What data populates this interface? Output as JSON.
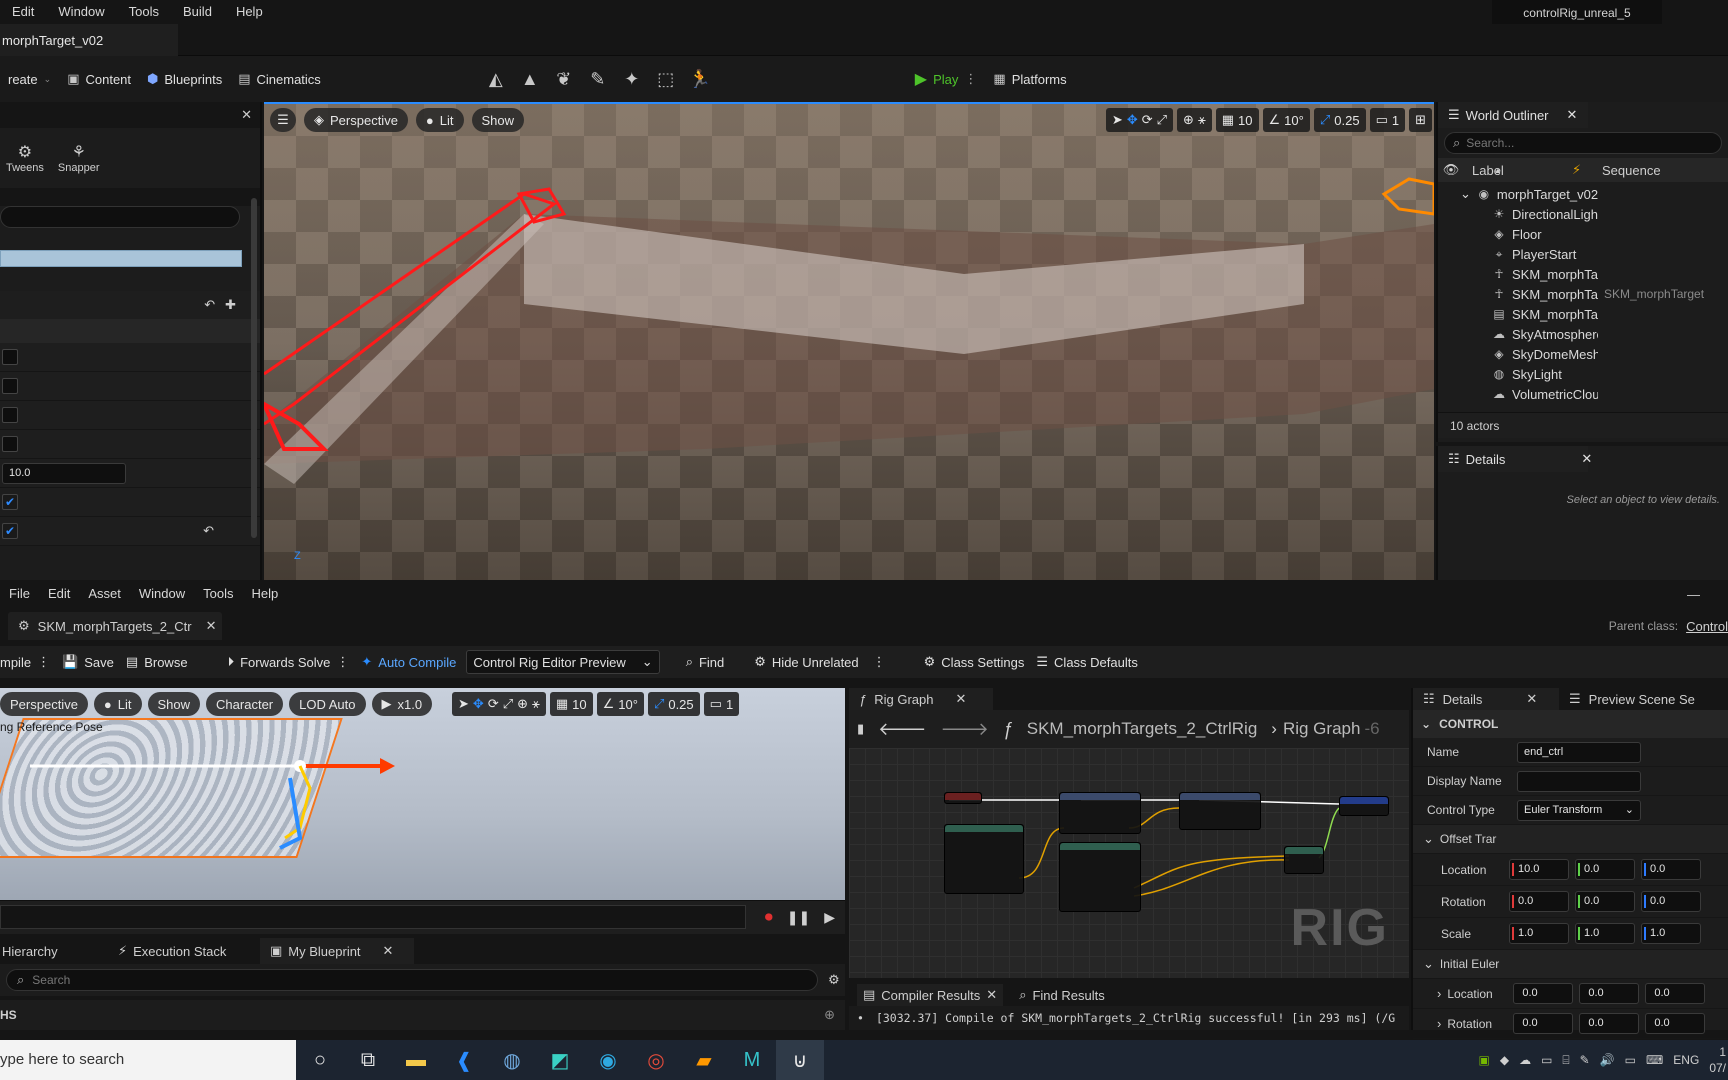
{
  "top_menu": [
    "Edit",
    "Window",
    "Tools",
    "Build",
    "Help"
  ],
  "project_name": "controlRig_unreal_5",
  "level_tab": "morphTarget_v02",
  "main_toolbar": {
    "create": "reate",
    "content": "Content",
    "blueprints": "Blueprints",
    "cinematics": "Cinematics",
    "play": "Play",
    "platforms": "Platforms"
  },
  "left_panel": {
    "tool_tweens": "Tweens",
    "tool_snapper": "Snapper",
    "value_field": "10.0"
  },
  "main_viewport": {
    "perspective": "Perspective",
    "lit": "Lit",
    "show": "Show",
    "grid_snap": "10",
    "rot_snap": "10°",
    "scale_snap": "0.25",
    "camera_speed": "1",
    "axis_z": "Z"
  },
  "world_outliner": {
    "title": "World Outliner",
    "search_placeholder": "Search...",
    "col_label": "Label",
    "col_sequence": "Sequence",
    "items": [
      {
        "label": "morphTarget_v02",
        "icon": "world-icon",
        "sequence": ""
      },
      {
        "label": "DirectionalLight",
        "icon": "sun-icon",
        "sequence": ""
      },
      {
        "label": "Floor",
        "icon": "cube-icon",
        "sequence": ""
      },
      {
        "label": "PlayerStart",
        "icon": "gamepad-icon",
        "sequence": ""
      },
      {
        "label": "SKM_morphTar",
        "icon": "skeleton-icon",
        "sequence": ""
      },
      {
        "label": "SKM_morphTar",
        "icon": "skeleton-icon",
        "sequence": "SKM_morphTarget"
      },
      {
        "label": "SKM_morphTar",
        "icon": "sequence-icon",
        "sequence": ""
      },
      {
        "label": "SkyAtmosphere",
        "icon": "atmosphere-icon",
        "sequence": ""
      },
      {
        "label": "SkyDomeMesh",
        "icon": "cube-icon",
        "sequence": ""
      },
      {
        "label": "SkyLight",
        "icon": "skylight-icon",
        "sequence": ""
      },
      {
        "label": "VolumetricClou",
        "icon": "cloud-icon",
        "sequence": ""
      }
    ],
    "actor_count": "10 actors"
  },
  "details_top": {
    "title": "Details",
    "empty_text": "Select an object to view details."
  },
  "cr_menu": [
    "File",
    "Edit",
    "Asset",
    "Window",
    "Tools",
    "Help"
  ],
  "cr_tab": "SKM_morphTargets_2_Ctr",
  "parent_class_label": "Parent class:",
  "parent_class_value": "Control",
  "cr_toolbar": {
    "compile": "mpile",
    "save": "Save",
    "browse": "Browse",
    "forwards_solve": "Forwards Solve",
    "auto_compile": "Auto Compile",
    "preview_dropdown": "Control Rig Editor Preview",
    "find": "Find",
    "hide_unrelated": "Hide Unrelated",
    "class_settings": "Class Settings",
    "class_defaults": "Class Defaults"
  },
  "preview": {
    "perspective": "Perspective",
    "lit": "Lit",
    "show": "Show",
    "character": "Character",
    "lod": "LOD Auto",
    "speed": "x1.0",
    "grid_snap": "10",
    "rot_snap": "10°",
    "scale_snap": "0.25",
    "camera_speed": "1",
    "overlay_text": "ng Reference Pose"
  },
  "bottom_tabs": {
    "hierarchy": "Hierarchy",
    "execution_stack": "Execution Stack",
    "my_blueprint": "My Blueprint",
    "search_placeholder": "Search",
    "graphs": "HS"
  },
  "rig_graph": {
    "tab": "Rig Graph",
    "breadcrumb_asset": "SKM_morphTargets_2_CtrlRig",
    "breadcrumb_graph": "Rig Graph",
    "zoom": "-6",
    "watermark": "RIG"
  },
  "compiler": {
    "tab_results": "Compiler Results",
    "tab_find": "Find Results",
    "message": "[3032.37] Compile of SKM_morphTargets_2_CtrlRig successful! [in 293 ms] (/G"
  },
  "cr_details": {
    "tab": "Details",
    "tab2": "Preview Scene Se",
    "section": "CONTROL",
    "name_label": "Name",
    "name_value": "end_ctrl",
    "display_name_label": "Display Name",
    "display_name_value": "",
    "control_type_label": "Control Type",
    "control_type_value": "Euler Transform",
    "offset_label": "Offset Trar",
    "location_label": "Location",
    "location": [
      "10.0",
      "0.0",
      "0.0"
    ],
    "rotation_label": "Rotation",
    "rotation": [
      "0.0",
      "0.0",
      "0.0"
    ],
    "scale_label": "Scale",
    "scale": [
      "1.0",
      "1.0",
      "1.0"
    ],
    "initial_label": "Initial Euler",
    "init_location_label": "Location",
    "init_location": [
      "0.0",
      "0.0",
      "0.0"
    ],
    "init_rotation_label": "Rotation",
    "init_rotation": [
      "0.0",
      "0.0",
      "0.0"
    ]
  },
  "taskbar": {
    "search_placeholder": "ype here to search",
    "lang": "ENG",
    "time": "1",
    "date": "07/"
  },
  "colors": {
    "accent": "#2a8cff",
    "play_green": "#4ec32a",
    "selection_red": "#ff1a1a"
  }
}
